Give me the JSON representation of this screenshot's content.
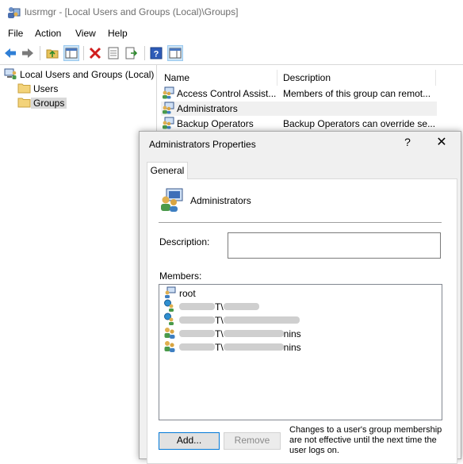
{
  "window": {
    "title": "lusrmgr - [Local Users and Groups (Local)\\Groups]",
    "menu": [
      "File",
      "Action",
      "View",
      "Help"
    ],
    "toolbar": [
      "back-arrow-icon",
      "forward-arrow-icon",
      "up-folder-icon",
      "show-hide-tree-icon",
      "delete-icon",
      "properties-icon",
      "export-list-icon",
      "help-icon",
      "show-action-pane-icon"
    ]
  },
  "tree": {
    "root": "Local Users and Groups (Local)",
    "children": [
      "Users",
      "Groups"
    ],
    "selected": "Groups"
  },
  "list": {
    "columns": [
      "Name",
      "Description"
    ],
    "rows": [
      {
        "name": "Access Control Assist...",
        "description": "Members of this group can remot..."
      },
      {
        "name": "Administrators",
        "description": ""
      },
      {
        "name": "Backup Operators",
        "description": "Backup Operators can override se..."
      }
    ]
  },
  "dialog": {
    "title": "Administrators Properties",
    "help": "?",
    "close": "✕",
    "tab": "General",
    "group_name": "Administrators",
    "description_label": "Description:",
    "description_value": "",
    "members_label": "Members:",
    "members": [
      {
        "prefix": "",
        "suffix": "root",
        "redacted": false
      },
      {
        "prefix": "T\\",
        "suffix": "",
        "redacted": true
      },
      {
        "prefix": "T\\",
        "suffix": "",
        "redacted": true
      },
      {
        "prefix": "T\\",
        "suffix": "nins",
        "redacted": true
      },
      {
        "prefix": "T\\",
        "suffix": "nins",
        "redacted": true
      }
    ],
    "add_button": "Add...",
    "remove_button": "Remove",
    "note": "Changes to a user's group membership are not effective until the next time the user logs on."
  }
}
